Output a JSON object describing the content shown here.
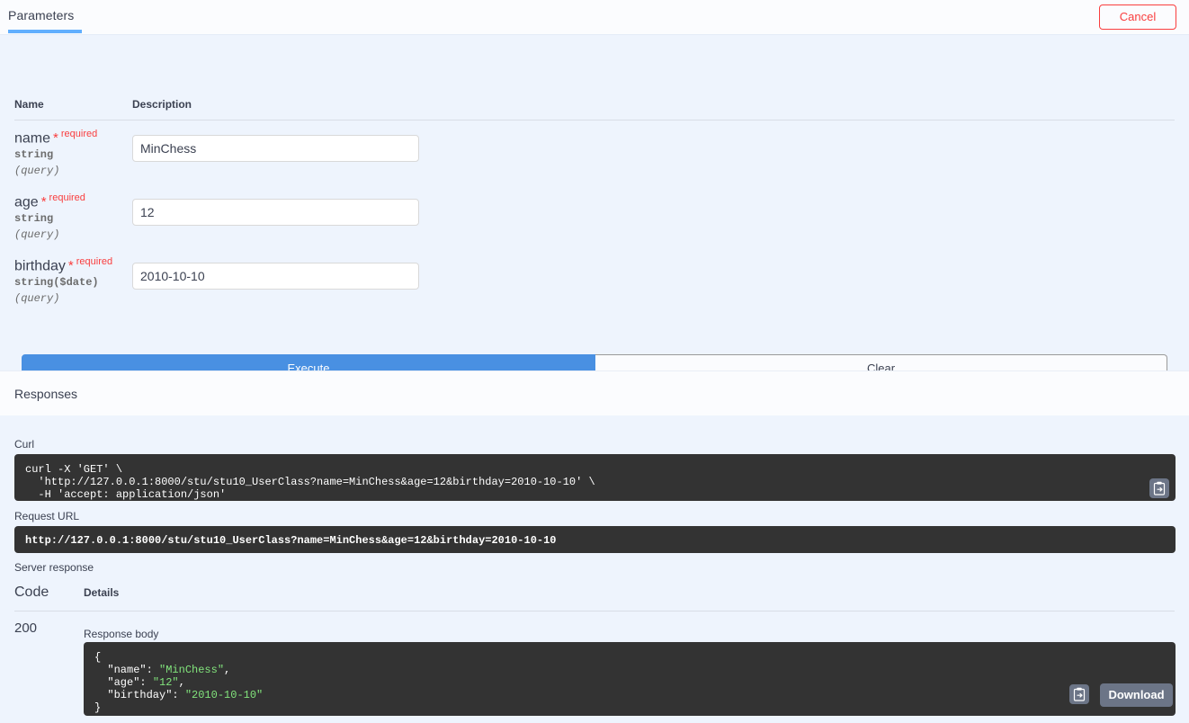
{
  "header": {
    "tab_label": "Parameters",
    "cancel_label": "Cancel"
  },
  "parameters": {
    "col_name": "Name",
    "col_description": "Description",
    "required_label": "required",
    "star": "*",
    "rows": [
      {
        "name": "name",
        "type": "string",
        "in": "(query)",
        "value": "MinChess"
      },
      {
        "name": "age",
        "type": "string",
        "in": "(query)",
        "value": "12"
      },
      {
        "name": "birthday",
        "type": "string($date)",
        "in": "(query)",
        "value": "2010-10-10"
      }
    ]
  },
  "actions": {
    "execute_label": "Execute",
    "clear_label": "Clear"
  },
  "responses": {
    "section_title": "Responses",
    "curl_label": "Curl",
    "curl_cmd": "curl -X 'GET' \\",
    "curl_url": "  'http://127.0.0.1:8000/stu/stu10_UserClass?name=MinChess&age=12&birthday=2010-10-10' \\",
    "curl_header": "  -H 'accept: application/json'",
    "request_url_label": "Request URL",
    "request_url": "http://127.0.0.1:8000/stu/stu10_UserClass?name=MinChess&age=12&birthday=2010-10-10",
    "server_response_label": "Server response",
    "col_code": "Code",
    "col_details": "Details",
    "status_code": "200",
    "response_body_label": "Response body",
    "body_open": "{",
    "body_line_name_key": "  \"name\": ",
    "body_line_name_val": "\"MinChess\"",
    "body_line_name_end": ",",
    "body_line_age_key": "  \"age\": ",
    "body_line_age_val": "\"12\"",
    "body_line_age_end": ",",
    "body_line_birthday_key": "  \"birthday\": ",
    "body_line_birthday_val": "\"2010-10-10\"",
    "body_close": "}",
    "download_label": "Download",
    "copy_icon": "clipboard-copy-icon"
  },
  "colors": {
    "accent_blue": "#4990e2",
    "tab_underline": "#61affe",
    "required_red": "#f93e3e",
    "code_bg": "#333333",
    "string_green": "#82e47c",
    "page_bg": "#eef4fd"
  }
}
